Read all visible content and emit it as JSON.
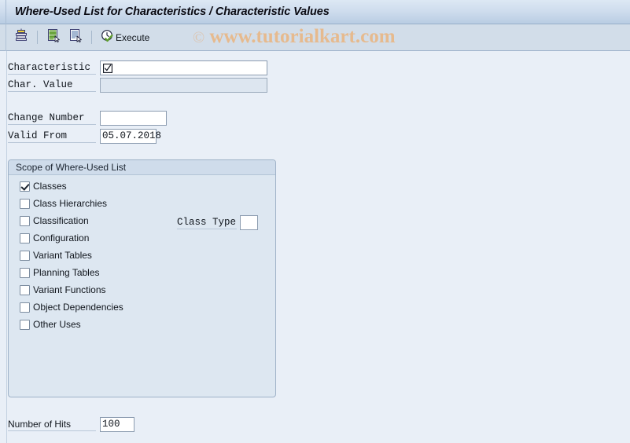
{
  "window": {
    "title": "Where-Used List for Characteristics / Characteristic Values"
  },
  "toolbar": {
    "items": [
      {
        "name": "print-list-icon",
        "label": ""
      },
      {
        "name": "list-with-cursor-icon",
        "label": ""
      },
      {
        "name": "document-with-cursor-icon",
        "label": ""
      }
    ],
    "execute_label": "Execute"
  },
  "watermark": {
    "copyright_symbol": "©",
    "text": "www.tutorialkart.com"
  },
  "selection": {
    "characteristic": {
      "label": "Characteristic",
      "value": "",
      "marker": "☑"
    },
    "char_value": {
      "label": "Char. Value",
      "value": "",
      "disabled": true
    },
    "change_number": {
      "label": "Change Number",
      "value": ""
    },
    "valid_from": {
      "label": "Valid From",
      "value": "05.07.2018"
    }
  },
  "scope": {
    "title": "Scope of Where-Used List",
    "checkboxes": [
      {
        "label": "Classes",
        "checked": true
      },
      {
        "label": "Class Hierarchies",
        "checked": false
      },
      {
        "label": "Classification",
        "checked": false
      },
      {
        "label": "Configuration",
        "checked": false
      },
      {
        "label": "Variant Tables",
        "checked": false
      },
      {
        "label": "Planning Tables",
        "checked": false
      },
      {
        "label": "Variant Functions",
        "checked": false
      },
      {
        "label": "Object Dependencies",
        "checked": false
      },
      {
        "label": "Other Uses",
        "checked": false
      }
    ],
    "class_type": {
      "label": "Class Type",
      "value": ""
    }
  },
  "hits": {
    "label": "Number of Hits",
    "value": "100"
  },
  "colors": {
    "titlebar_top": "#dde8f4",
    "titlebar_bottom": "#b9cde3",
    "toolbar_bg": "#d2dde9",
    "canvas_bg": "#e9eff7",
    "groupbox_bg": "#dde7f1",
    "watermark": "#e8b98a",
    "accent_green": "#5f9e2f"
  }
}
